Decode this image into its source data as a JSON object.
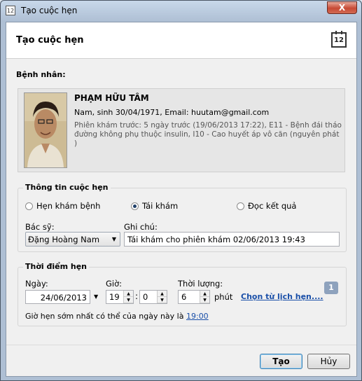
{
  "window": {
    "title": "Tạo cuộc hẹn",
    "close_label": "X",
    "icon_text": "12"
  },
  "header": {
    "title": "Tạo cuộc hẹn",
    "calendar_icon_text": "12"
  },
  "patient": {
    "section_label": "Bệnh nhân:",
    "name": "PHẠM HỮU TÂM",
    "info": "Nam, sinh 30/04/1971, Email: huutam@gmail.com",
    "history": "Phiên khám trước: 5 ngày trước (19/06/2013 17:22), E11 - Bệnh đái tháo đường không phụ thuộc insulin, I10 - Cao huyết áp vô căn (nguyên phát )"
  },
  "appointment_info": {
    "group_title": "Thông tin cuộc hẹn",
    "types": [
      {
        "label": "Hẹn khám bệnh",
        "selected": false
      },
      {
        "label": "Tái khám",
        "selected": true
      },
      {
        "label": "Đọc kết quả",
        "selected": false
      }
    ],
    "doctor_label": "Bác sỹ:",
    "doctor_value": "Đặng Hoàng Nam",
    "note_label": "Ghi chú:",
    "note_value": "Tái khám cho phiên khám 02/06/2013 19:43"
  },
  "appointment_time": {
    "group_title": "Thời điểm hẹn",
    "date_label": "Ngày:",
    "date_value": "24/06/2013",
    "hour_label": "Giờ:",
    "hour_value": "19",
    "separator": ":",
    "minute_value": "0",
    "duration_label": "Thời lượng:",
    "duration_value": "6",
    "duration_unit": "phút",
    "choose_link": "Chọn từ lịch hẹn....",
    "badge": "1",
    "earliest_text": "Giờ hẹn sớm nhất có thể của ngày này là",
    "earliest_time": "19:00"
  },
  "buttons": {
    "create": "Tạo",
    "cancel": "Hủy"
  }
}
